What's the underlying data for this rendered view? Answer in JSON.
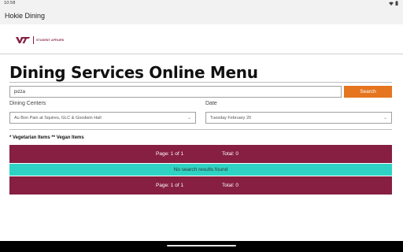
{
  "status_bar": {
    "time": "10:58",
    "wifi_icon": "wifi-icon",
    "battery_icon": "battery-icon"
  },
  "app_bar": {
    "title": "Hokie Dining"
  },
  "logo": {
    "brand_text": "STUDENT AFFAIRS",
    "brand_color": "#861f41"
  },
  "page": {
    "title": "Dining Services Online Menu"
  },
  "search": {
    "value": "pizza",
    "button_label": "Search",
    "button_color": "#e5751f"
  },
  "filters": {
    "centers_label": "Dining Centers",
    "centers_selected": "Au Bon Pain at Squires, GLC & Goodwin Hall",
    "date_label": "Date",
    "date_selected": "Tuesday February 20"
  },
  "legend": {
    "text": "* Vegetarian Items  ** Vegan Items"
  },
  "results": {
    "pager_top": {
      "page": "Page: 1 of 1",
      "total": "Total: 0"
    },
    "no_results": "No search results found",
    "pager_bottom": {
      "page": "Page: 1 of 1",
      "total": "Total: 0"
    },
    "pager_color": "#861f41",
    "notice_color": "#2fd3c3"
  }
}
